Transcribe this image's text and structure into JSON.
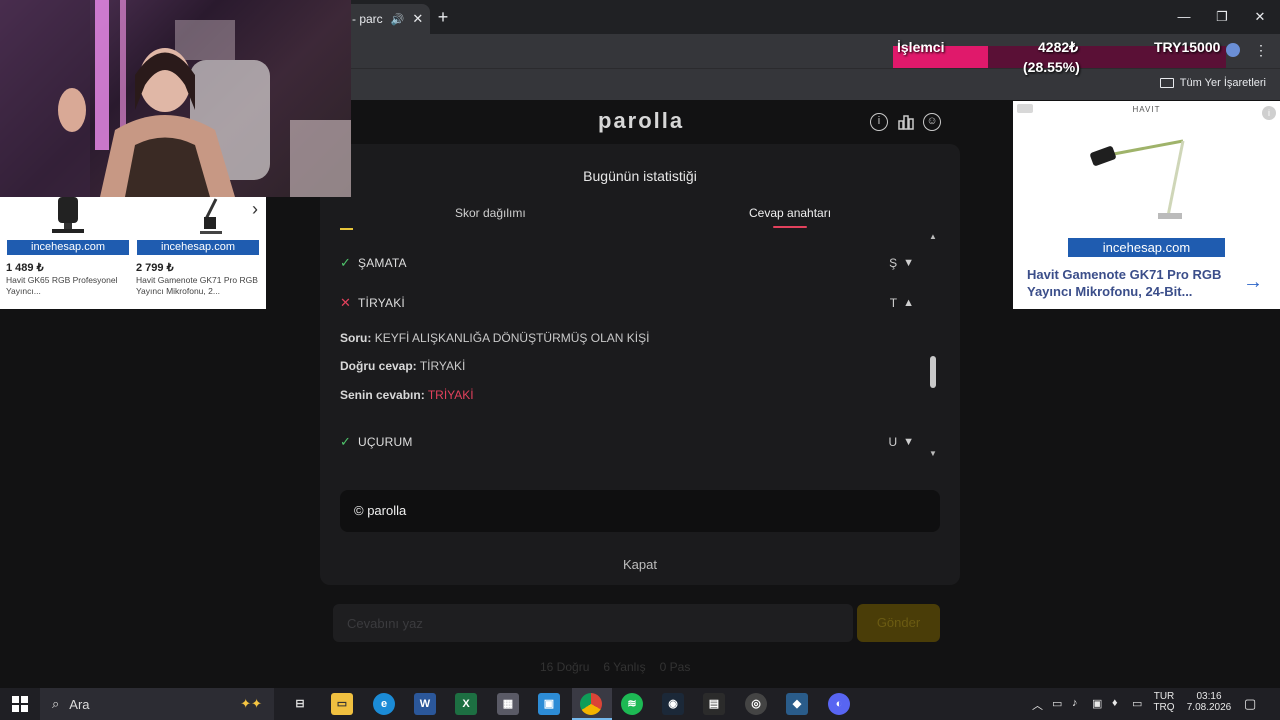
{
  "browser": {
    "tab_title": "- parc",
    "new_tab_symbol": "+",
    "window_controls": {
      "minimize": "—",
      "maximize": "❐",
      "close": "✕"
    },
    "bookmarks_label": "Tüm Yer İşaretleri"
  },
  "cpu_overlay": {
    "label": "İşlemci",
    "value": "4282₺",
    "percent_text": "(28.55%)",
    "percent": 28.55,
    "target": "TRY15000",
    "fill_color": "#e0196b",
    "bar_color": "#5a1036"
  },
  "site": {
    "logo": "parolla",
    "icons": [
      "info-icon",
      "stats-icon",
      "profile-icon"
    ]
  },
  "modal": {
    "title": "Bugünün istatistiği",
    "tabs": [
      {
        "label": "Skor dağılımı",
        "active": false
      },
      {
        "label": "Cevap anahtarı",
        "active": true
      }
    ],
    "answers": [
      {
        "word": "ŞAMATA",
        "letter": "Ş",
        "correct": true,
        "expanded": false
      },
      {
        "word": "TİRYAKİ",
        "letter": "T",
        "correct": false,
        "expanded": true
      },
      {
        "word": "UÇURUM",
        "letter": "U",
        "correct": true,
        "expanded": false
      }
    ],
    "detail": {
      "question_label": "Soru:",
      "question": "KEYFİ ALIŞKANLIĞA DÖNÜŞTÜRMÜŞ OLAN KİŞİ",
      "correct_label": "Doğru cevap:",
      "correct_answer": "TİRYAKİ",
      "your_label": "Senin cevabın:",
      "your_answer": "TRİYAKİ"
    },
    "copyright": "© parolla",
    "close_label": "Kapat"
  },
  "background_page": {
    "input_placeholder": "Cevabını yaz",
    "submit_label": "Gönder",
    "stats": [
      "16 Doğru",
      "6 Yanlış",
      "0 Pas"
    ]
  },
  "left_ad": {
    "brand": "incehesap.com",
    "products": [
      {
        "price": "1 489 ₺",
        "name": "Havit GK65 RGB Profesyonel Yayıncı..."
      },
      {
        "price": "2 799 ₺",
        "name": "Havit Gamenote GK71 Pro RGB Yayıncı Mikrofonu, 2..."
      }
    ],
    "next_symbol": "›"
  },
  "right_ad": {
    "brand_top": "HAVIT",
    "brand": "incehesap.com",
    "title": "Havit Gamenote GK71 Pro RGB Yayıncı Mikrofonu, 24-Bit...",
    "arrow": "→"
  },
  "taskbar": {
    "search_label": "Ara",
    "apps": [
      "task-view",
      "file-explorer",
      "edge",
      "word",
      "excel",
      "calculator",
      "store",
      "chrome",
      "spotify",
      "steam",
      "obs",
      "app-1",
      "app-2",
      "app-3"
    ],
    "language": {
      "line1": "TUR",
      "line2": "TRQ"
    },
    "time": "03:16",
    "date": "7.08.2026"
  }
}
